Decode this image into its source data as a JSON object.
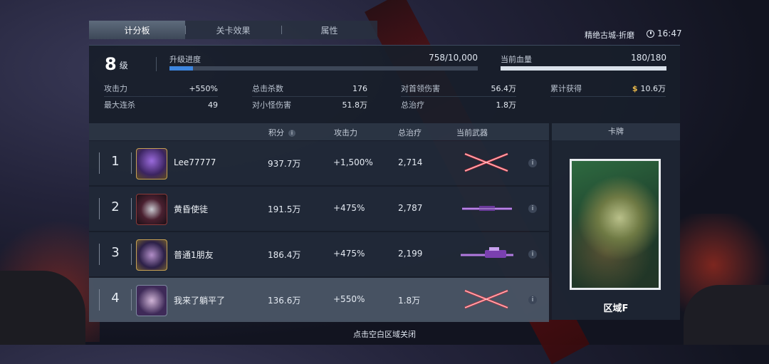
{
  "tabs": [
    {
      "label": "计分板",
      "active": true
    },
    {
      "label": "关卡效果",
      "active": false
    },
    {
      "label": "属性",
      "active": false
    }
  ],
  "location": "精绝古城-折磨",
  "clock": "16:47",
  "level": {
    "number": "8",
    "unit": "级"
  },
  "xp": {
    "label": "升级进度",
    "value": "758/10,000",
    "progress": 0.0758
  },
  "hp": {
    "label": "当前血量",
    "value": "180/180",
    "progress": 1.0
  },
  "stats": {
    "attack": {
      "label": "攻击力",
      "value": "+550%"
    },
    "total_kills": {
      "label": "总击杀数",
      "value": "176"
    },
    "boss_damage": {
      "label": "对首领伤害",
      "value": "56.4万"
    },
    "earned": {
      "label": "累计获得",
      "value": "10.6万",
      "currency_icon": "$"
    },
    "max_streak": {
      "label": "最大连杀",
      "value": "49"
    },
    "minion_damage": {
      "label": "对小怪伤害",
      "value": "51.8万"
    },
    "total_heal": {
      "label": "总治疗",
      "value": "1.8万"
    }
  },
  "table": {
    "headers": {
      "score": "积分",
      "attack": "攻击力",
      "heal": "总治疗",
      "weapon": "当前武器",
      "card": "卡牌"
    },
    "rows": [
      {
        "rank": "1",
        "name": "Lee77777",
        "score": "937.7万",
        "attack": "+1,500%",
        "heal": "2,714",
        "weapon_icon": "twin-red-blades-icon"
      },
      {
        "rank": "2",
        "name": "黄昏使徒",
        "score": "191.5万",
        "attack": "+475%",
        "heal": "2,787",
        "weapon_icon": "purple-rifle-icon"
      },
      {
        "rank": "3",
        "name": "普通1朋友",
        "score": "186.4万",
        "attack": "+475%",
        "heal": "2,199",
        "weapon_icon": "purple-sniper-icon"
      },
      {
        "rank": "4",
        "name": "我来了躺平了",
        "score": "136.6万",
        "attack": "+550%",
        "heal": "1.8万",
        "weapon_icon": "twin-red-blades-icon",
        "is_self": true
      }
    ]
  },
  "card": {
    "name": "区域F"
  },
  "close_hint": "点击空白区域关闭",
  "colors": {
    "accent_blue": "#3d86e0",
    "gold": "#e8b84a",
    "weapon_red": "#e0434f",
    "weapon_purple": "#a05ad8"
  }
}
